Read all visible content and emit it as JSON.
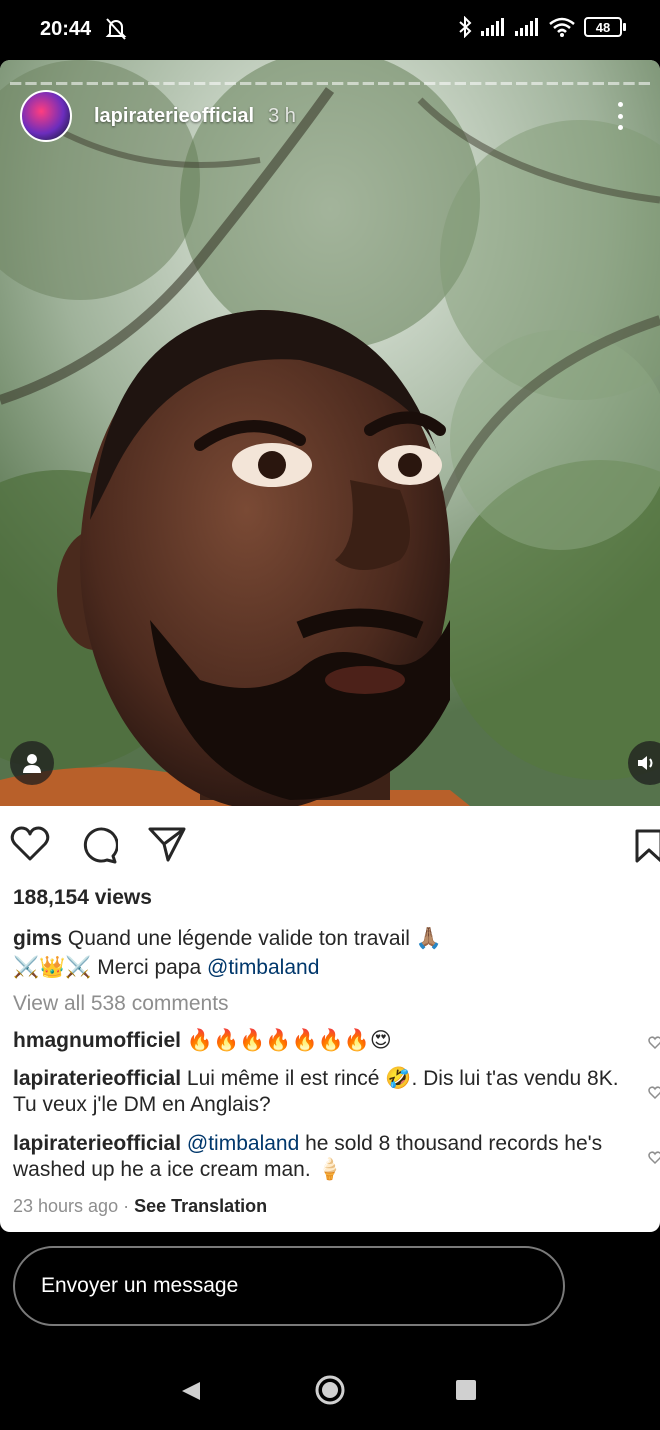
{
  "status_bar": {
    "time": "20:44",
    "battery": "48"
  },
  "story": {
    "username": "lapiraterieofficial",
    "time_ago": "3 h",
    "segments_count": 42,
    "segments_viewed": 0
  },
  "post": {
    "views": "188,154 views",
    "caption": {
      "author": "gims",
      "text_line1": "Quand une légende valide ton travail 🙏🏽",
      "text_line2_prefix": "⚔️👑⚔️ Merci papa ",
      "mention": "@timbaland"
    },
    "view_all_comments": "View all 538 comments",
    "comments": [
      {
        "author": "hmagnumofficiel",
        "text": "🔥🔥🔥🔥🔥🔥🔥😍"
      },
      {
        "author": "lapiraterieofficial",
        "text": "Lui même il est rincé 🤣. Dis lui t'as vendu 8K. Tu veux j'le DM en Anglais?"
      },
      {
        "author": "lapiraterieofficial",
        "mention": "@timbaland",
        "text": " he sold 8 thousand records he's washed up he a ice cream man. 🍦"
      }
    ],
    "timestamp": "23 hours ago",
    "separator": "·",
    "see_translation": "See Translation"
  },
  "message_input": {
    "placeholder": "Envoyer un message"
  },
  "icons": {
    "like": "heart-icon",
    "comment": "comment-icon",
    "share": "send-icon",
    "save": "bookmark-icon",
    "profile": "person-icon",
    "sound": "speaker-icon"
  },
  "colors": {
    "mention": "#00376b",
    "muted": "#8e8e8e",
    "text": "#262626"
  }
}
